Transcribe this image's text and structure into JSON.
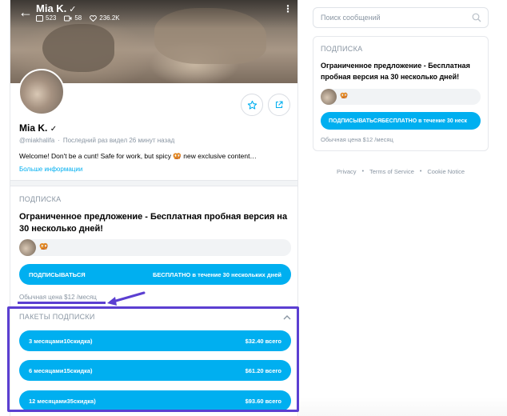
{
  "header": {
    "name": "Mia K.",
    "posts_count": "523",
    "videos_count": "58",
    "likes_count": "236.2K"
  },
  "profile": {
    "name": "Mia K.",
    "handle": "@miakhalifa",
    "separator": "·",
    "last_seen": "Последний раз видел 26 минут назад",
    "bio": "Welcome! Don't be a cunt! Safe for work, but spicy 🥨 new exclusive content…",
    "more_info": "Больше информации"
  },
  "subscription": {
    "section_title": "ПОДПИСКА",
    "offer_title": "Ограниченное предложение - Бесплатная пробная версия на 30 несколько дней!",
    "promo_emoji": "🥨",
    "subscribe_label": "ПОДПИСЫВАТЬСЯ",
    "free_label": "БЕСПЛАТНО в течение 30 нескольких дней",
    "regular_price": "Обычная цена $12 /месяц"
  },
  "bundles": {
    "section_title": "ПАКЕТЫ ПОДПИСКИ",
    "items": [
      {
        "label": "3 месяцами10скидка)",
        "price": "$32.40 всего"
      },
      {
        "label": "6 месяцами15скидка)",
        "price": "$61.20 всего"
      },
      {
        "label": "12 месяцами35скидка)",
        "price": "$93.60 всего"
      }
    ]
  },
  "sidebar": {
    "search_placeholder": "Поиск сообщений",
    "card_title": "ПОДПИСКА",
    "offer_title": "Ограниченное предложение - Бесплатная пробная версия на 30 несколько дней!",
    "promo_emoji": "🥨",
    "subscribe_button": "ПОДПИСЫВАТЬСЯБЕСПЛАТНО в течение 30 неск",
    "regular_price": "Обычная цена $12 /месяц"
  },
  "footer": {
    "privacy": "Privacy",
    "terms": "Terms of Service",
    "cookie": "Cookie Notice",
    "dot": "•"
  },
  "colors": {
    "accent": "#00aff0",
    "annotation": "#5b3fd1",
    "muted_text": "#8a96a3"
  },
  "icons": [
    "back-arrow-icon",
    "verified-icon",
    "posts-icon",
    "video-icon",
    "heart-icon",
    "more-icon",
    "star-icon",
    "share-icon",
    "chevron-up-icon",
    "search-icon"
  ]
}
